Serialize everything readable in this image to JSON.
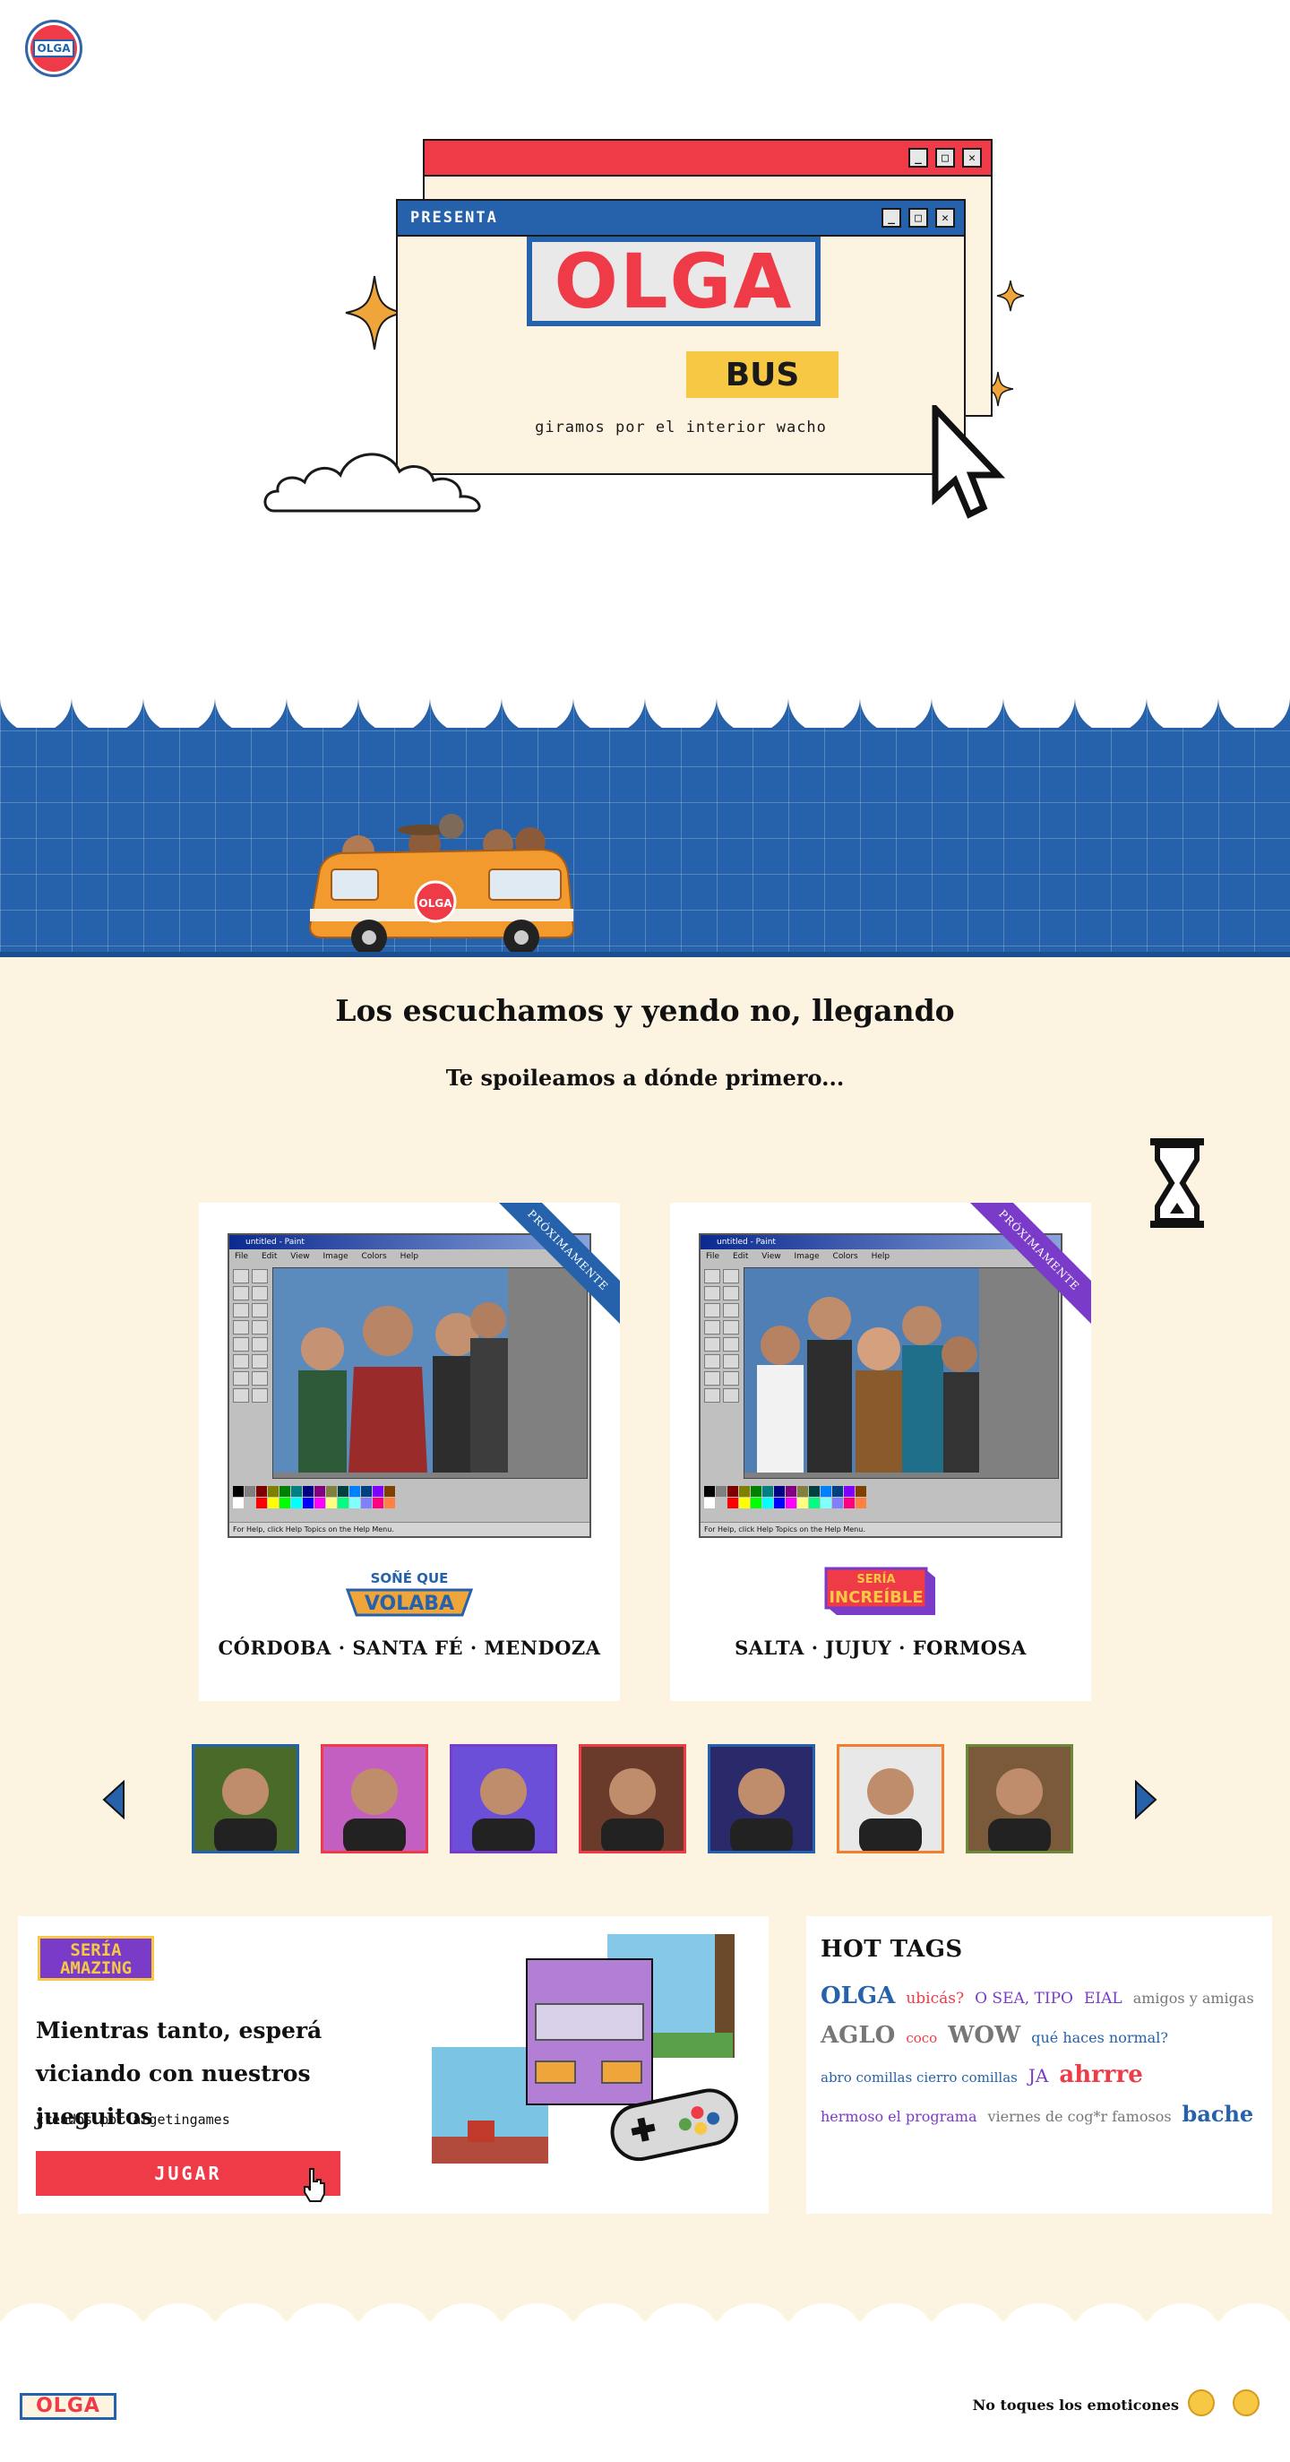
{
  "brand": {
    "logo_text": "OLGA",
    "footer_logo_text": "OLGA"
  },
  "hero": {
    "window_title": "PRESENTA",
    "logo_word": "OLGA",
    "logo_tag": "BUS",
    "tagline": "giramos por el interior wacho",
    "window_controls": [
      "_",
      "□",
      "✕"
    ]
  },
  "section": {
    "title": "Los escuchamos y yendo no, llegando",
    "subtitle": "Te spoileamos a dónde primero..."
  },
  "paint_window": {
    "title": "untitled - Paint",
    "menu": [
      "File",
      "Edit",
      "View",
      "Image",
      "Colors",
      "Help"
    ],
    "status": "For Help, click Help Topics on the Help Menu."
  },
  "tour_cards": [
    {
      "ribbon": "PRÓXIMAMENTE",
      "show_logo_line1": "SOÑÉ QUE",
      "show_logo_line2": "VOLABA",
      "cities": "CÓRDOBA · SANTA FÉ · MENDOZA"
    },
    {
      "ribbon": "PRÓXIMAMENTE",
      "show_logo_line1": "SERÍA",
      "show_logo_line2": "INCREÍBLE",
      "cities": "SALTA · JUJUY · FORMOSA"
    }
  ],
  "games": {
    "badge_line1": "SERÍA",
    "badge_line2": "AMAZING",
    "title": "Mientras tanto, esperá viciando con nuestros jueguitos",
    "credit": "creados por argetingames",
    "play_label": "JUGAR"
  },
  "hot_tags": {
    "title": "HOT TAGS",
    "rows": [
      [
        {
          "text": "OLGA",
          "color": "#2662ab"
        },
        {
          "text": "ubicás?",
          "color": "#ef3a47"
        },
        {
          "text": "O SEA, TIPO",
          "color": "#7a3bc8"
        },
        {
          "text": "EIAL",
          "color": "#7a3bc8"
        },
        {
          "text": "amigos y amigas",
          "color": "#777777"
        }
      ],
      [
        {
          "text": "AGLO",
          "color": "#777777"
        },
        {
          "text": "coco",
          "color": "#ef3a47"
        },
        {
          "text": "WOW",
          "color": "#777777"
        },
        {
          "text": "qué haces normal?",
          "color": "#2662ab"
        }
      ],
      [
        {
          "text": "abro comillas cierro comillas",
          "color": "#2662ab"
        },
        {
          "text": "JA",
          "color": "#7a3bc8"
        },
        {
          "text": "ahrrre",
          "color": "#ef3a47"
        }
      ],
      [
        {
          "text": "hermoso el programa",
          "color": "#7a3bc8"
        },
        {
          "text": "viernes de cog*r famosos",
          "color": "#777777"
        },
        {
          "text": "bache",
          "color": "#2662ab"
        }
      ]
    ]
  },
  "footer": {
    "text": "No toques los emoticones"
  },
  "colors": {
    "red": "#ef3a47",
    "blue": "#2662ab",
    "cream": "#fdf3e1",
    "yellow": "#f7c843",
    "purple": "#7a3bc8"
  }
}
